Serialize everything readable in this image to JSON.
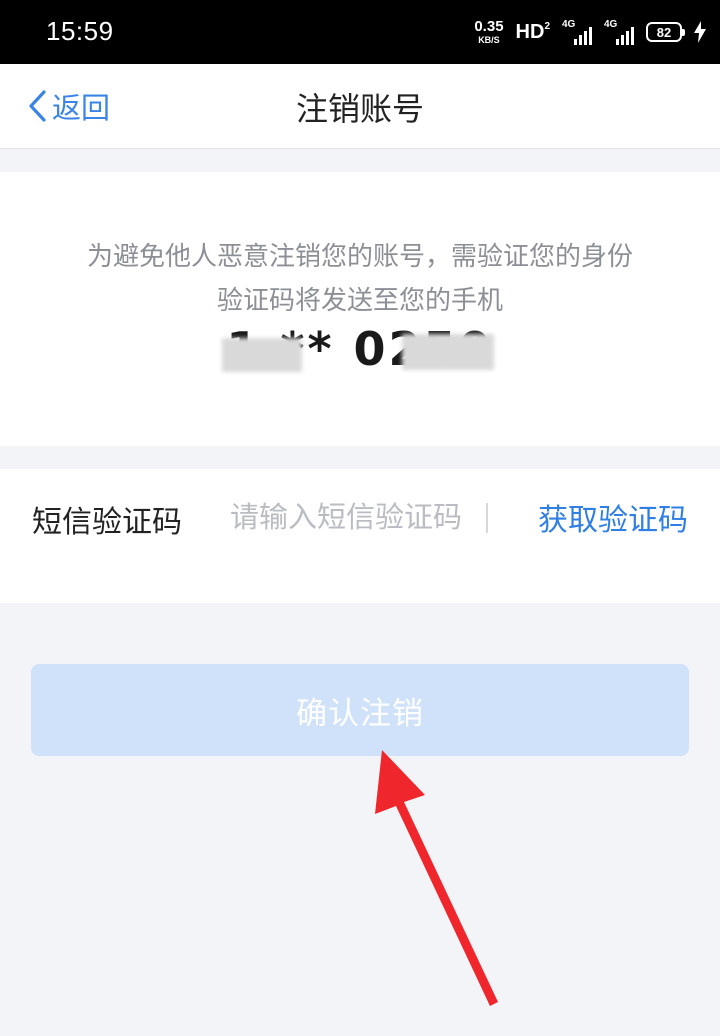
{
  "status_bar": {
    "time": "15:59",
    "net_speed_value": "0.35",
    "net_speed_unit": "KB/S",
    "hd_label": "HD",
    "hd_sub": "2",
    "sim1_gen": "4G",
    "sim2_gen": "4G",
    "battery": "82"
  },
  "nav": {
    "back_label": "返回",
    "title": "注销账号"
  },
  "info": {
    "line1": "为避免他人恶意注销您的账号，需验证您的身份",
    "line2": "验证码将发送至您的手机",
    "phone_masked": "1   ** 0250"
  },
  "sms": {
    "label": "短信验证码",
    "input_value": "",
    "placeholder": "请输入短信验证码",
    "get_code_label": "获取验证码"
  },
  "confirm": {
    "label": "确认注销",
    "enabled": false
  },
  "colors": {
    "accent": "#2f7fe4",
    "button_disabled_bg": "#cfe2fa",
    "page_bg": "#f3f4f8",
    "annotation": "#f0262d"
  }
}
